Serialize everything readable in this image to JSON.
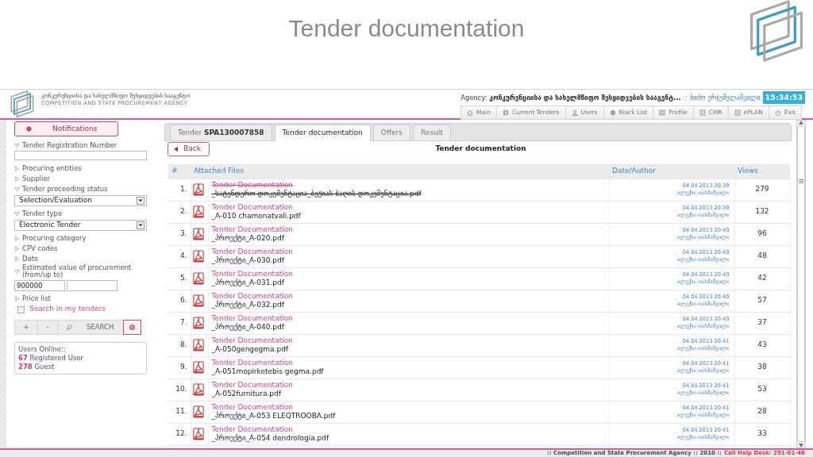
{
  "slide": {
    "title": "Tender documentation"
  },
  "header": {
    "agency_name_ka": "კონკურენციისა და სახელმწიფო შესყიდვების სააგენტო",
    "agency_name_en": "COMPETITION AND STATE PROCUREMENT AGENCY",
    "agency_label": "Agency:",
    "agency_value": "კონკურენციისა და სახელმწიფო შესყიდვების სააგენტ...",
    "separator": "::",
    "user": "ბიძო ურჯუმელაშვილი",
    "time": "15:34:53"
  },
  "nav": [
    "Main",
    "Current Tenders",
    "Users",
    "Black List",
    "Profile",
    "CMR",
    "ePLAN",
    "Exit"
  ],
  "sidebar": {
    "notifications": "Notifications",
    "filters": [
      {
        "kind": "text",
        "label": "Tender Registration Number",
        "expanded": true
      },
      {
        "kind": "group",
        "label": "Procuring entities",
        "expanded": false
      },
      {
        "kind": "group",
        "label": "Supplier",
        "expanded": false
      },
      {
        "kind": "select",
        "label": "Tender proceeding status",
        "expanded": true,
        "value": "Selection/Evaluation"
      },
      {
        "kind": "select",
        "label": "Tender type",
        "expanded": true,
        "value": "Electronic Tender"
      },
      {
        "kind": "group",
        "label": "Procuring category",
        "expanded": false
      },
      {
        "kind": "group",
        "label": "CPV codes",
        "expanded": false
      },
      {
        "kind": "group",
        "label": "Date",
        "expanded": false
      },
      {
        "kind": "range",
        "label": "Estimated value of procurement (from/up to)",
        "expanded": true,
        "from": "900000"
      },
      {
        "kind": "group",
        "label": "Price list",
        "expanded": false
      }
    ],
    "my_tenders": {
      "label": "Search in my tenders",
      "checked": false
    },
    "buttons": [
      "+",
      "-",
      "SEARCH"
    ],
    "users_online": {
      "title": "Users Online::",
      "registered_count": "67",
      "registered_label": "Registered User",
      "guest_count": "278",
      "guest_label": "Guest"
    }
  },
  "tabs": [
    {
      "label": "Tender **SPA130007858**",
      "selected": false
    },
    {
      "label": "Tender documentation",
      "selected": true
    },
    {
      "label": "Offers",
      "selected": false
    },
    {
      "label": "Result",
      "selected": false
    }
  ],
  "back_button": "Back",
  "section_title": "Tender documentation",
  "table": {
    "columns": [
      "#",
      "Attached Files",
      "Date/Author",
      "Views"
    ],
    "rows": [
      {
        "number": "1.",
        "title": "Tender Documentation",
        "file": "_სატენდერო დოკუმენტაცია_ბეჟიას ბაღის დოკუმენტაცია.pdf",
        "date": "04.04.2013 20:39",
        "author": "ალექსი თახმაშვილი",
        "views": "279",
        "struck": true
      },
      {
        "number": "2.",
        "title": "Tender Documentation",
        "file": "_A-010 chamonatvali.pdf",
        "date": "04.04.2013 20:39",
        "author": "ალექსი თახმაშვილი",
        "views": "132",
        "struck": false
      },
      {
        "number": "3.",
        "title": "Tender Documentation",
        "file": "_პროექტი_A-020.pdf",
        "date": "04.04.2013 20:40",
        "author": "ალექსი თახმაშვილი",
        "views": "96",
        "struck": false
      },
      {
        "number": "4.",
        "title": "Tender Documentation",
        "file": "_პროექტი_A-030.pdf",
        "date": "04.04.2013 20:40",
        "author": "ალექსი თახმაშვილი",
        "views": "48",
        "struck": false
      },
      {
        "number": "5.",
        "title": "Tender Documentation",
        "file": "_პროექტი_A-031.pdf",
        "date": "04.04.2013 20:40",
        "author": "ალექსი თახმაშვილი",
        "views": "42",
        "struck": false
      },
      {
        "number": "6.",
        "title": "Tender Documentation",
        "file": "_პროექტი_A-032.pdf",
        "date": "04.04.2013 20:40",
        "author": "ალექსი თახმაშვილი",
        "views": "57",
        "struck": false
      },
      {
        "number": "7.",
        "title": "Tender Documentation",
        "file": "_პროექტი_A-040.pdf",
        "date": "04.04.2013 20:40",
        "author": "ალექსი თახმაშვილი",
        "views": "37",
        "struck": false
      },
      {
        "number": "8.",
        "title": "Tender Documentation",
        "file": "_A-050gengegma.pdf",
        "date": "04.04.2013 20:41",
        "author": "ალექსი თახმაშვილი",
        "views": "43",
        "struck": false
      },
      {
        "number": "9.",
        "title": "Tender Documentation",
        "file": "_A-051mopirketebis gegma.pdf",
        "date": "04.04.2013 20:41",
        "author": "ალექსი თახმაშვილი",
        "views": "38",
        "struck": false
      },
      {
        "number": "10.",
        "title": "Tender Documentation",
        "file": "_A-052furnitura.pdf",
        "date": "04.04.2013 20:41",
        "author": "ალექსი თახმაშვილი",
        "views": "53",
        "struck": false
      },
      {
        "number": "11.",
        "title": "Tender Documentation",
        "file": "_პროექტი_A-053 ELEQTROOBA.pdf",
        "date": "04.04.2013 20:41",
        "author": "ალექსი თახმაშვილი",
        "views": "28",
        "struck": false
      },
      {
        "number": "12.",
        "title": "Tender Documentation",
        "file": "_პროექტი_A-054 dendrologia.pdf",
        "date": "04.04.2013 20:41",
        "author": "ალექსი თახმაშვილი",
        "views": "33",
        "struck": false
      }
    ]
  },
  "footer": {
    "text": ":: Competition and State Procurement Agency :: 2010 ::",
    "help_desk": "Call Help Desk: 291-01-48"
  }
}
